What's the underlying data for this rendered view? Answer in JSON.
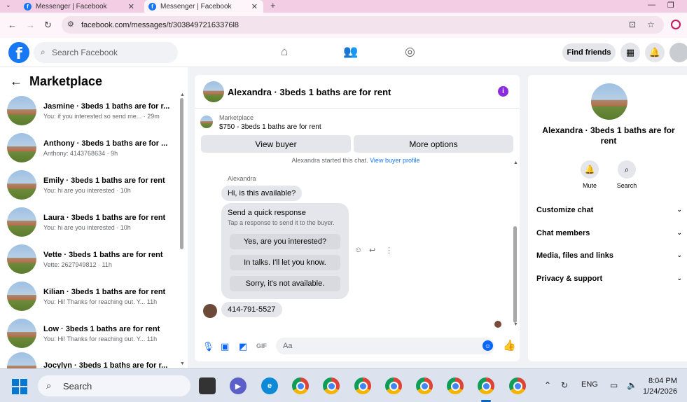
{
  "browser": {
    "tabs": [
      {
        "title": "Messenger | Facebook"
      },
      {
        "title": "Messenger | Facebook"
      }
    ],
    "url": "facebook.com/messages/t/30384972163376l8"
  },
  "header": {
    "search_placeholder": "Search Facebook",
    "find_friends": "Find friends"
  },
  "sidebar": {
    "title": "Marketplace",
    "conversations": [
      {
        "name": "Jasmine · 3beds 1 baths are for r...",
        "preview": "You: if you interested so send me... · 29m"
      },
      {
        "name": "Anthony · 3beds 1 baths are for ...",
        "preview": "Anthony: 4143768634 · 9h"
      },
      {
        "name": "Emily · 3beds 1 baths are for rent",
        "preview": "You: hi are you interested · 10h"
      },
      {
        "name": "Laura · 3beds 1 baths are for rent",
        "preview": "You: hi are you interested · 10h"
      },
      {
        "name": "Vette · 3beds 1 baths are for rent",
        "preview": "Vette: 2627949812 · 11h"
      },
      {
        "name": "Kilian · 3beds 1 baths are for rent",
        "preview": "You: Hi! Thanks for reaching out. Y... 11h"
      },
      {
        "name": "Low · 3beds 1 baths are for rent",
        "preview": "You: Hi! Thanks for reaching out. Y... 11h"
      },
      {
        "name": "Jocylyn · 3beds 1 baths are for r...",
        "preview": ""
      }
    ]
  },
  "chat": {
    "title": "Alexandra · 3beds 1 baths are for rent",
    "marketplace_label": "Marketplace",
    "listing": "$750 - 3beds 1 baths are for rent",
    "view_buyer": "View buyer",
    "more_options": "More options",
    "started_text": "Alexandra started this chat.",
    "started_link": "View buyer profile",
    "sender": "Alexandra",
    "msg1": "Hi, is this available?",
    "quick_title": "Send a quick response",
    "quick_sub": "Tap a response to send it to the buyer.",
    "quick_options": [
      "Yes, are you interested?",
      "In talks. I'll let you know.",
      "Sorry, it's not available."
    ],
    "msg2": "414-791-5527",
    "composer_placeholder": "Aa"
  },
  "details": {
    "name": "Alexandra · 3beds 1 baths are for rent",
    "mute": "Mute",
    "search": "Search",
    "sections": [
      "Customize chat",
      "Chat members",
      "Media, files and links",
      "Privacy & support"
    ]
  },
  "taskbar": {
    "search": "Search",
    "lang": "ENG",
    "time": "8:04 PM",
    "date": "1/24/2026"
  },
  "colors": {
    "accent": "#1877f2",
    "info": "#8a2be2",
    "tabbar": "#f2cde4"
  }
}
